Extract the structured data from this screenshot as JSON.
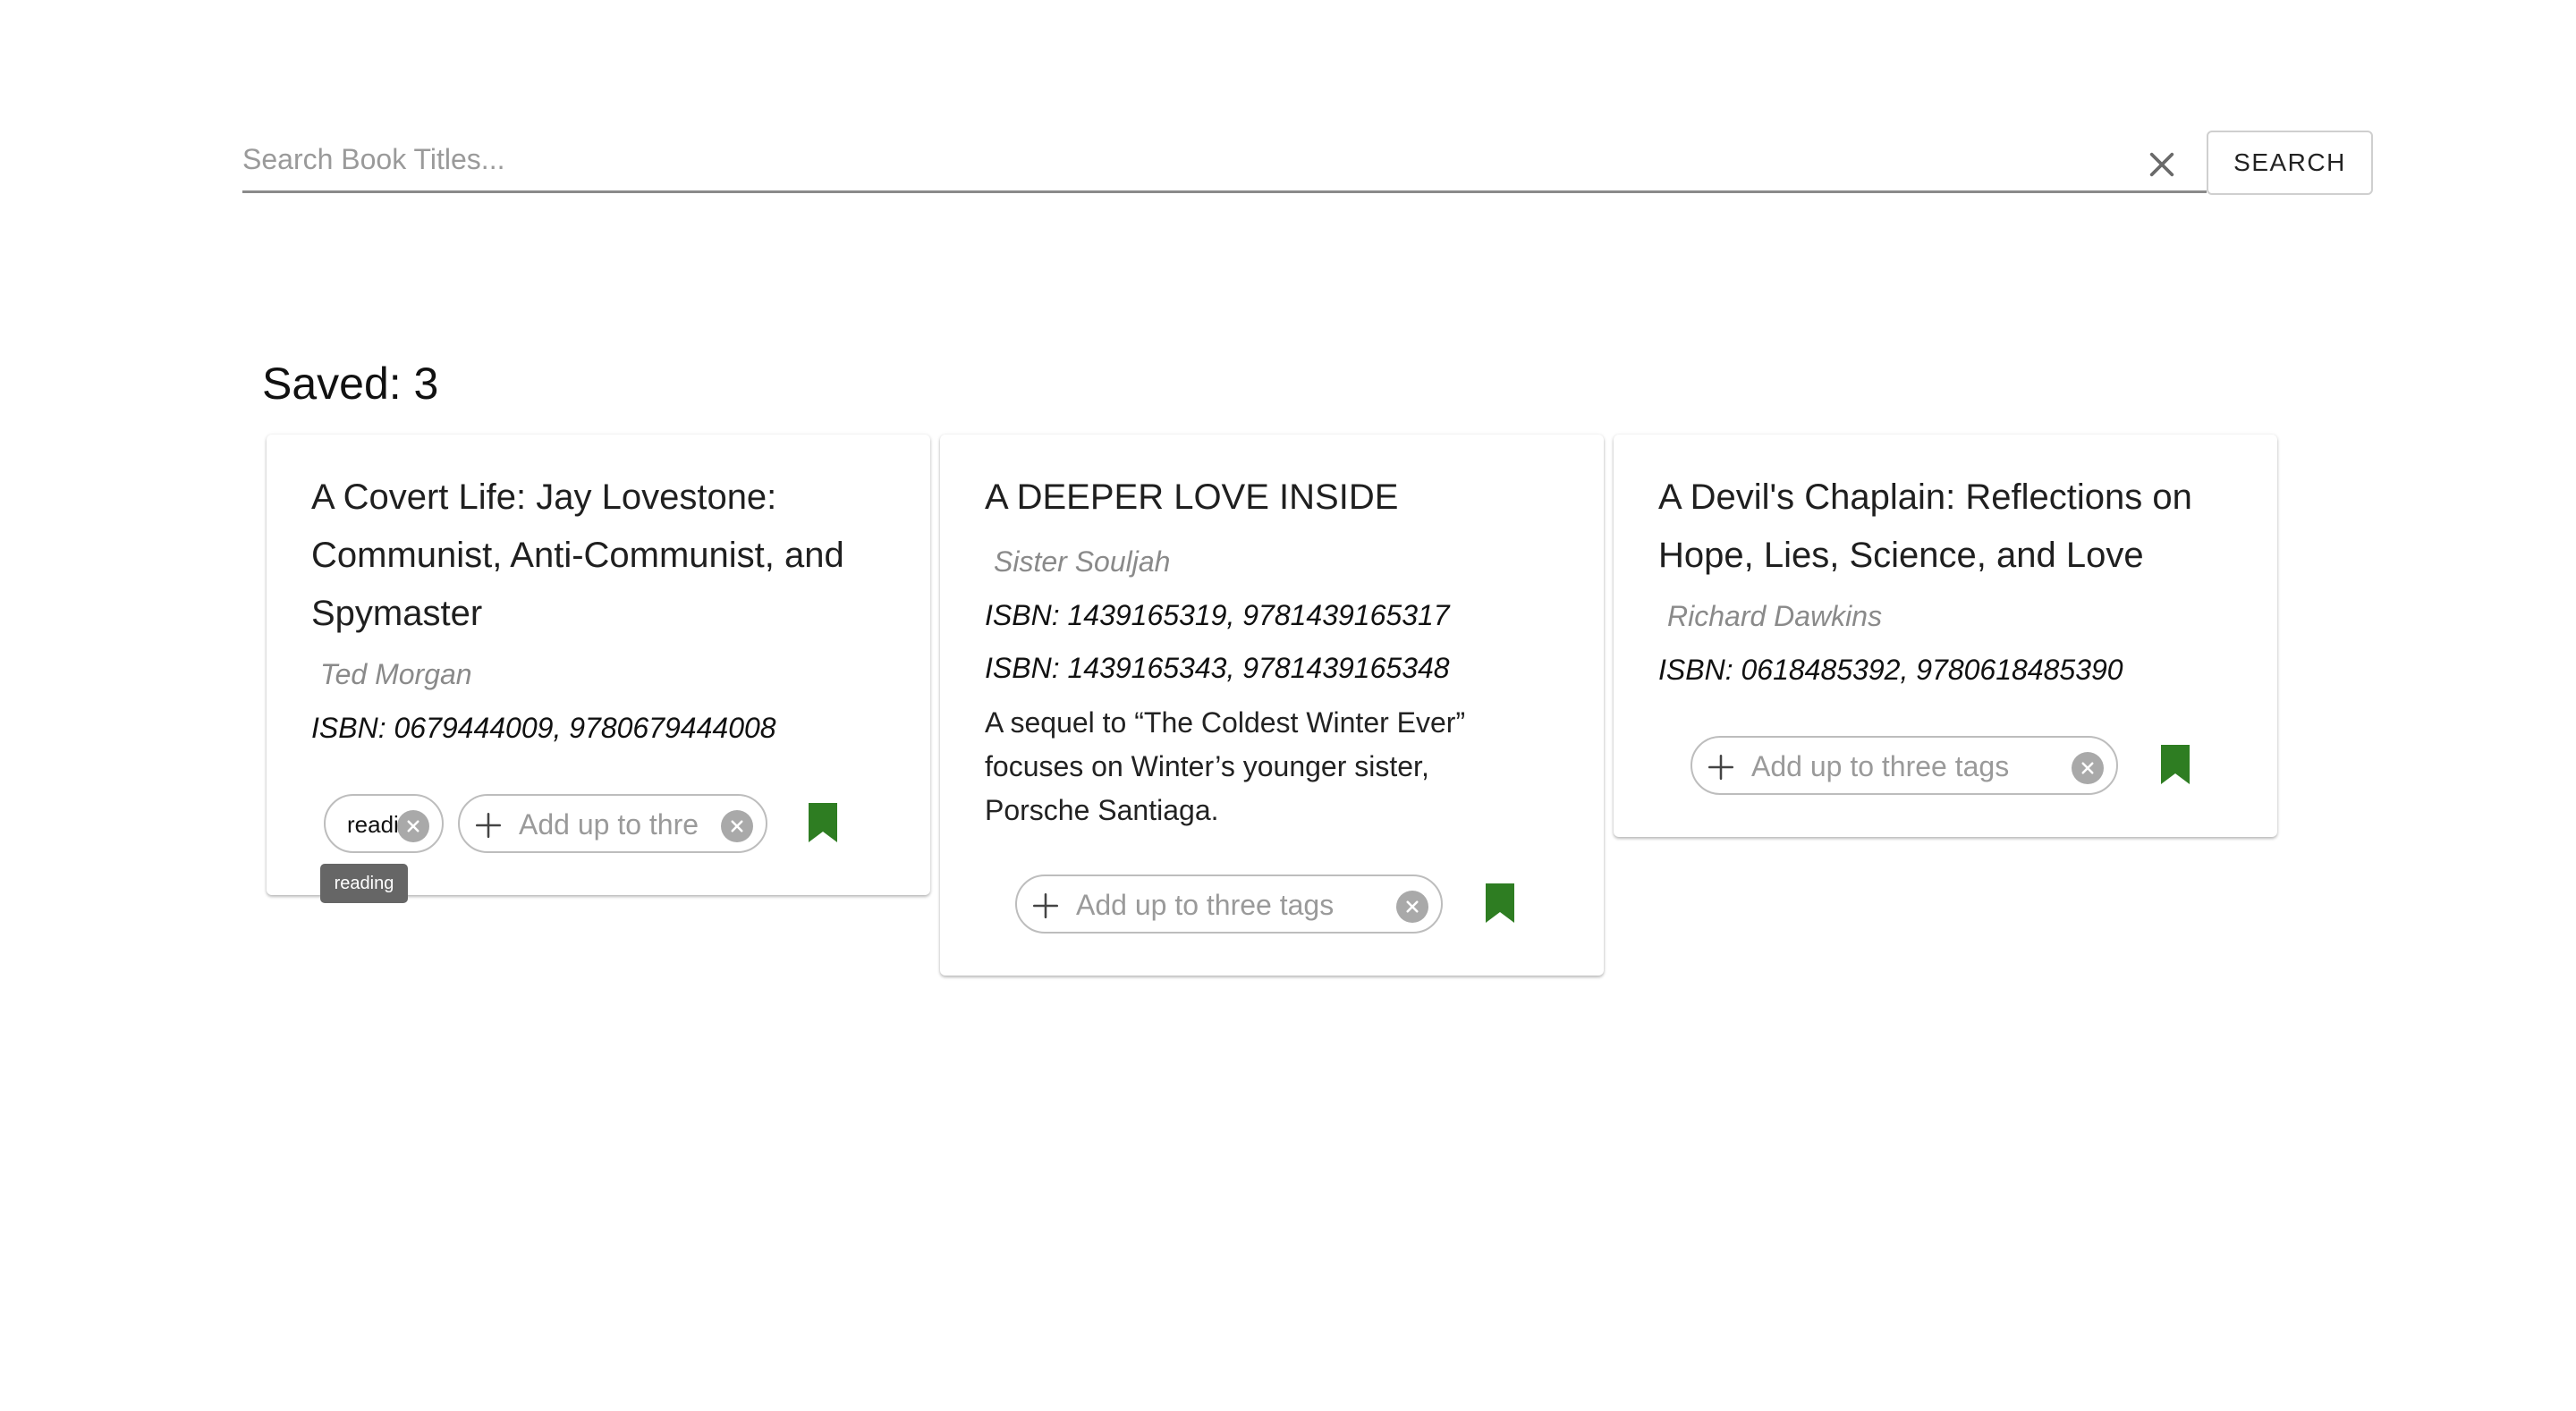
{
  "search": {
    "placeholder": "Search Book Titles...",
    "value": "",
    "clear_icon": "close-icon",
    "button_label": "SEARCH"
  },
  "saved": {
    "label": "Saved: 3"
  },
  "colors": {
    "bookmark": "#2e7d22",
    "chip_x": "#a9a9a9",
    "tooltip_bg": "#666666"
  },
  "books": [
    {
      "title": "A Covert Life: Jay Lovestone: Communist, Anti-Communist, and Spymaster",
      "author": "Ted Morgan",
      "isbns": [
        "ISBN: 0679444009, 9780679444008"
      ],
      "description": "",
      "tags": [
        "readi"
      ],
      "add_tag_placeholder": "Add up to thre",
      "bookmark_icon": "bookmark-icon"
    },
    {
      "title": "A DEEPER LOVE INSIDE",
      "author": "Sister Souljah",
      "isbns": [
        "ISBN: 1439165319, 9781439165317",
        "ISBN: 1439165343, 9781439165348"
      ],
      "description": "A sequel to “The Coldest Winter Ever” focuses on Winter’s younger sister, Porsche Santiaga.",
      "tags": [],
      "add_tag_placeholder": "Add up to three tags",
      "bookmark_icon": "bookmark-icon"
    },
    {
      "title": "A Devil's Chaplain: Reflections on Hope, Lies, Science, and Love",
      "author": "Richard Dawkins",
      "isbns": [
        "ISBN: 0618485392, 9780618485390"
      ],
      "description": "",
      "tags": [],
      "add_tag_placeholder": "Add up to three tags",
      "bookmark_icon": "bookmark-icon"
    }
  ],
  "tooltip": {
    "text": "reading"
  }
}
